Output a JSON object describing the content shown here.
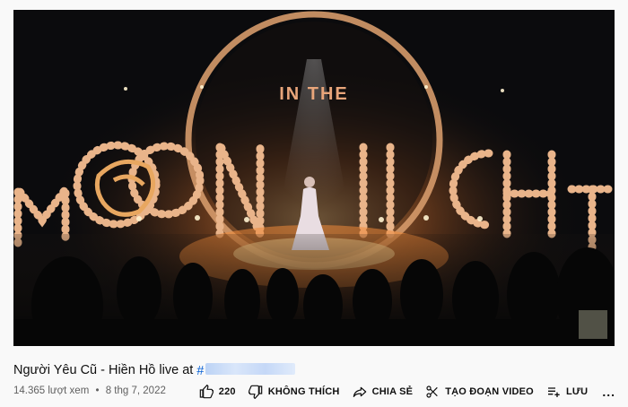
{
  "video": {
    "title": "Người Yêu Cũ - Hiền Hồ live at",
    "hashtag_prefix": "#",
    "overlay_text_top": "IN THE",
    "overlay_text_main": "MOONLIGHT"
  },
  "meta": {
    "views": "14.365 lượt xem",
    "separator": "•",
    "date": "8 thg 7, 2022"
  },
  "actions": {
    "like_count": "220",
    "dislike_label": "KHÔNG THÍCH",
    "share_label": "CHIA SẺ",
    "clip_label": "TẠO ĐOẠN VIDEO",
    "save_label": "LƯU",
    "more_label": "..."
  }
}
